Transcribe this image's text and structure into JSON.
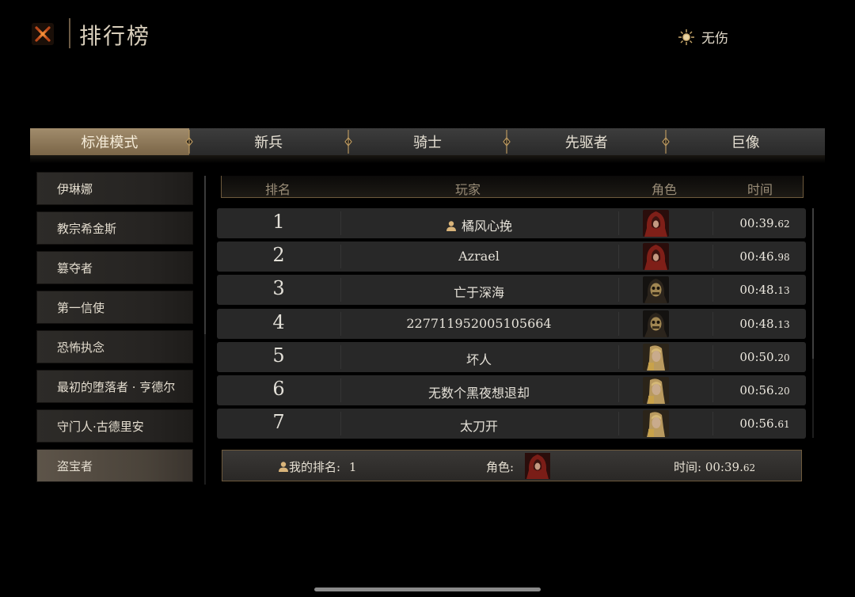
{
  "header": {
    "title": "排行榜",
    "mode_label": "无伤"
  },
  "tabs": [
    {
      "label": "标准模式",
      "active": true
    },
    {
      "label": "新兵",
      "active": false
    },
    {
      "label": "骑士",
      "active": false
    },
    {
      "label": "先驱者",
      "active": false
    },
    {
      "label": "巨像",
      "active": false
    }
  ],
  "sidebar": [
    {
      "label": "伊琳娜",
      "active": false
    },
    {
      "label": "教宗希金斯",
      "active": false
    },
    {
      "label": "篡夺者",
      "active": false
    },
    {
      "label": "第一信使",
      "active": false
    },
    {
      "label": "恐怖执念",
      "active": false
    },
    {
      "label": "最初的堕落者 · 亨德尔",
      "active": false
    },
    {
      "label": "守门人·古德里安",
      "active": false
    },
    {
      "label": "盗宝者",
      "active": true
    }
  ],
  "table": {
    "headers": {
      "rank": "排名",
      "player": "玩家",
      "role": "角色",
      "time": "时间"
    },
    "rows": [
      {
        "rank": "1",
        "player": "橘风心挽",
        "is_me": true,
        "role_icon": "red-hood-portrait",
        "time_main": "00:39.",
        "time_ms": "62"
      },
      {
        "rank": "2",
        "player": "Azrael",
        "is_me": false,
        "role_icon": "red-hood-portrait",
        "time_main": "00:46.",
        "time_ms": "98"
      },
      {
        "rank": "3",
        "player": "亡于深海",
        "is_me": false,
        "role_icon": "skull-portrait",
        "time_main": "00:48.",
        "time_ms": "13"
      },
      {
        "rank": "4",
        "player": "227711952005105664",
        "is_me": false,
        "role_icon": "skull-portrait",
        "time_main": "00:48.",
        "time_ms": "13"
      },
      {
        "rank": "5",
        "player": "坏人",
        "is_me": false,
        "role_icon": "blonde-portrait",
        "time_main": "00:50.",
        "time_ms": "20"
      },
      {
        "rank": "6",
        "player": "无数个黑夜想退却",
        "is_me": false,
        "role_icon": "blonde-portrait",
        "time_main": "00:56.",
        "time_ms": "20"
      },
      {
        "rank": "7",
        "player": "太刀开",
        "is_me": false,
        "role_icon": "blonde-portrait",
        "time_main": "00:56.",
        "time_ms": "61"
      }
    ]
  },
  "my_rank": {
    "rank_label": "我的排名:",
    "rank_value": "1",
    "role_label": "角色:",
    "role_icon": "red-hood-portrait",
    "time_label": "时间:",
    "time_main": "00:39.",
    "time_ms": "62"
  },
  "colors": {
    "accent_gold": "#a18c6c",
    "border_brown": "#6e5a3d",
    "row_bg": "#282828",
    "close_icon": "#e06a2a"
  }
}
